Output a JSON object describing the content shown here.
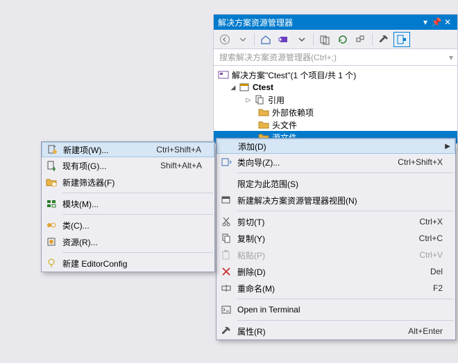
{
  "panel": {
    "title": "解决方案资源管理器",
    "search_placeholder": "搜索解决方案资源管理器(Ctrl+;)"
  },
  "tree": {
    "solution": "解决方案\"Ctest\"(1 个项目/共 1 个)",
    "project": "Ctest",
    "refs": "引用",
    "ext_deps": "外部依赖项",
    "headers": "头文件",
    "sources": "源文件"
  },
  "menu_right": {
    "add": "添加(D)",
    "class_wizard": "类向导(Z)...",
    "class_wizard_sc": "Ctrl+Shift+X",
    "scope": "限定为此范围(S)",
    "new_view": "新建解决方案资源管理器视图(N)",
    "cut": "剪切(T)",
    "cut_sc": "Ctrl+X",
    "copy": "复制(Y)",
    "copy_sc": "Ctrl+C",
    "paste": "粘贴(P)",
    "paste_sc": "Ctrl+V",
    "delete": "删除(D)",
    "delete_sc": "Del",
    "rename": "重命名(M)",
    "rename_sc": "F2",
    "terminal": "Open in Terminal",
    "properties": "属性(R)",
    "properties_sc": "Alt+Enter"
  },
  "menu_left": {
    "new_item": "新建项(W)...",
    "new_item_sc": "Ctrl+Shift+A",
    "existing_item": "现有项(G)...",
    "existing_item_sc": "Shift+Alt+A",
    "new_filter": "新建筛选器(F)",
    "module": "模块(M)...",
    "class": "类(C)...",
    "resource": "资源(R)...",
    "editorconfig": "新建 EditorConfig"
  }
}
